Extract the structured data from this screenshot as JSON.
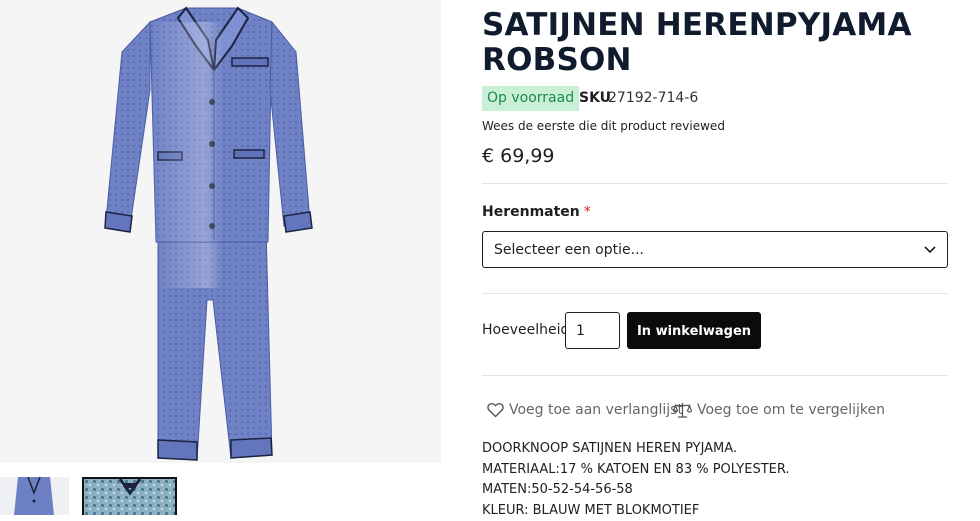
{
  "product": {
    "title": "SATIJNEN HERENPYJAMA ROBSON",
    "stock_status": "Op voorraad",
    "sku_label": "SKU",
    "sku_value": "27192-714-6",
    "review_link": "Wees de eerste die dit product reviewed",
    "price": "€ 69,99"
  },
  "size_option": {
    "label": "Herenmaten",
    "required_marker": "*",
    "placeholder": "Selecteer een optie..."
  },
  "add_to_cart": {
    "quantity_label": "Hoeveelheid",
    "quantity_value": "1",
    "button_label": "In winkelwagen"
  },
  "actions": {
    "wishlist_label": "Voeg toe aan verlanglijst",
    "compare_label": "Voeg toe om te vergelijken"
  },
  "description": {
    "lines": [
      "DOORKNOOP SATIJNEN HEREN PYJAMA.",
      "MATERIAAL:17 % KATOEN EN 83 % POLYESTER.",
      "MATEN:50-52-54-56-58",
      "KLEUR: BLAUW MET BLOKMOTIEF"
    ]
  },
  "colors": {
    "pajama": "#6d80c4",
    "pajama_shade": "#4b5ca3",
    "piping": "#1b2340",
    "in_stock_bg": "#c9f0d6",
    "in_stock_text": "#1d8a4b",
    "button_bg": "#0b0b0b"
  },
  "icons": [
    "chevron-down-icon",
    "heart-icon",
    "scale-icon"
  ]
}
